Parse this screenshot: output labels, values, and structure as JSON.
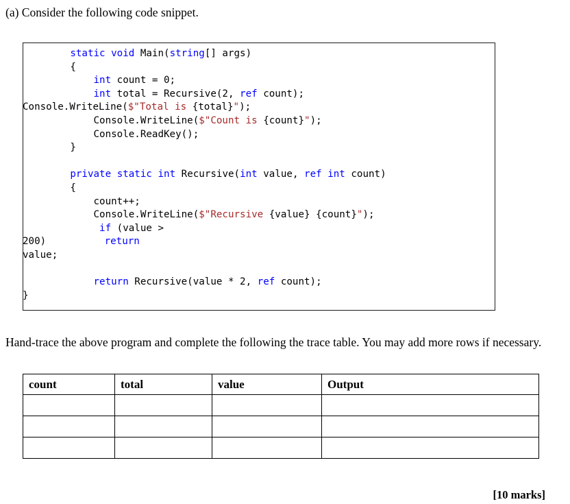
{
  "question": {
    "intro": "(a) Consider the following code snippet.",
    "instruction": "Hand-trace the above program and complete the following the trace table. You may add more rows if necessary.",
    "marks": "[10 marks]"
  },
  "code": {
    "language": "csharp",
    "colors": {
      "keyword": "#0000ff",
      "string": "#a52a2a",
      "plain": "#000000",
      "border": "#1a1a1a",
      "background": "#ffffff"
    },
    "lines": [
      {
        "indent": 8,
        "overflow_left": false,
        "tokens": [
          {
            "t": "static",
            "c": "k"
          },
          {
            "t": " ",
            "c": "n"
          },
          {
            "t": "void",
            "c": "k"
          },
          {
            "t": " Main(",
            "c": "n"
          },
          {
            "t": "string",
            "c": "k"
          },
          {
            "t": "[] args)",
            "c": "n"
          }
        ]
      },
      {
        "indent": 8,
        "overflow_left": false,
        "tokens": [
          {
            "t": "{",
            "c": "n"
          }
        ]
      },
      {
        "indent": 12,
        "overflow_left": false,
        "tokens": [
          {
            "t": "int",
            "c": "k"
          },
          {
            "t": " count = 0;",
            "c": "n"
          }
        ]
      },
      {
        "indent": 12,
        "overflow_left": false,
        "tokens": [
          {
            "t": "int",
            "c": "k"
          },
          {
            "t": " total = Recursive(2, ",
            "c": "n"
          },
          {
            "t": "ref",
            "c": "k"
          },
          {
            "t": " count);",
            "c": "n"
          }
        ]
      },
      {
        "indent": 0,
        "overflow_left": true,
        "tokens": [
          {
            "t": "Console.WriteLine(",
            "c": "n"
          },
          {
            "t": "$\"Total is ",
            "c": "s"
          },
          {
            "t": "{total}",
            "c": "n"
          },
          {
            "t": "\"",
            "c": "s"
          },
          {
            "t": ");",
            "c": "n"
          }
        ]
      },
      {
        "indent": 12,
        "overflow_left": false,
        "tokens": [
          {
            "t": "Console.WriteLine(",
            "c": "n"
          },
          {
            "t": "$\"Count is ",
            "c": "s"
          },
          {
            "t": "{count}",
            "c": "n"
          },
          {
            "t": "\"",
            "c": "s"
          },
          {
            "t": ");",
            "c": "n"
          }
        ]
      },
      {
        "indent": 12,
        "overflow_left": false,
        "tokens": [
          {
            "t": "Console.ReadKey();",
            "c": "n"
          }
        ]
      },
      {
        "indent": 8,
        "overflow_left": false,
        "tokens": [
          {
            "t": "}",
            "c": "n"
          }
        ]
      },
      {
        "indent": 0,
        "overflow_left": false,
        "tokens": []
      },
      {
        "indent": 8,
        "overflow_left": false,
        "tokens": [
          {
            "t": "private",
            "c": "k"
          },
          {
            "t": " ",
            "c": "n"
          },
          {
            "t": "static",
            "c": "k"
          },
          {
            "t": " ",
            "c": "n"
          },
          {
            "t": "int",
            "c": "k"
          },
          {
            "t": " Recursive(",
            "c": "n"
          },
          {
            "t": "int",
            "c": "k"
          },
          {
            "t": " value, ",
            "c": "n"
          },
          {
            "t": "ref",
            "c": "k"
          },
          {
            "t": " ",
            "c": "n"
          },
          {
            "t": "int",
            "c": "k"
          },
          {
            "t": " count)",
            "c": "n"
          }
        ]
      },
      {
        "indent": 8,
        "overflow_left": false,
        "tokens": [
          {
            "t": "{",
            "c": "n"
          }
        ]
      },
      {
        "indent": 12,
        "overflow_left": false,
        "tokens": [
          {
            "t": "count++;",
            "c": "n"
          }
        ]
      },
      {
        "indent": 12,
        "overflow_left": false,
        "tokens": [
          {
            "t": "Console.WriteLine(",
            "c": "n"
          },
          {
            "t": "$\"Recursive ",
            "c": "s"
          },
          {
            "t": "{value} {count}",
            "c": "n"
          },
          {
            "t": "\"",
            "c": "s"
          },
          {
            "t": ");",
            "c": "n"
          }
        ]
      },
      {
        "indent": 13,
        "overflow_left": false,
        "tokens": [
          {
            "t": "if",
            "c": "k"
          },
          {
            "t": " (value >",
            "c": "n"
          }
        ]
      },
      {
        "indent": 0,
        "overflow_left": true,
        "tokens": [
          {
            "t": "200)          ",
            "c": "n"
          },
          {
            "t": "return",
            "c": "k"
          }
        ]
      },
      {
        "indent": 0,
        "overflow_left": true,
        "tokens": [
          {
            "t": "value;",
            "c": "n"
          }
        ]
      },
      {
        "indent": 0,
        "overflow_left": false,
        "tokens": []
      },
      {
        "indent": 12,
        "overflow_left": false,
        "tokens": [
          {
            "t": "return",
            "c": "k"
          },
          {
            "t": " Recursive(value * 2, ",
            "c": "n"
          },
          {
            "t": "ref",
            "c": "k"
          },
          {
            "t": " count);",
            "c": "n"
          }
        ]
      },
      {
        "indent": 0,
        "overflow_left": true,
        "tokens": [
          {
            "t": "}",
            "c": "n"
          }
        ]
      }
    ]
  },
  "trace_table": {
    "headers": [
      "count",
      "total",
      "value",
      "Output"
    ],
    "rows": [
      [
        "",
        "",
        "",
        ""
      ],
      [
        "",
        "",
        "",
        ""
      ],
      [
        "",
        "",
        "",
        ""
      ]
    ]
  }
}
